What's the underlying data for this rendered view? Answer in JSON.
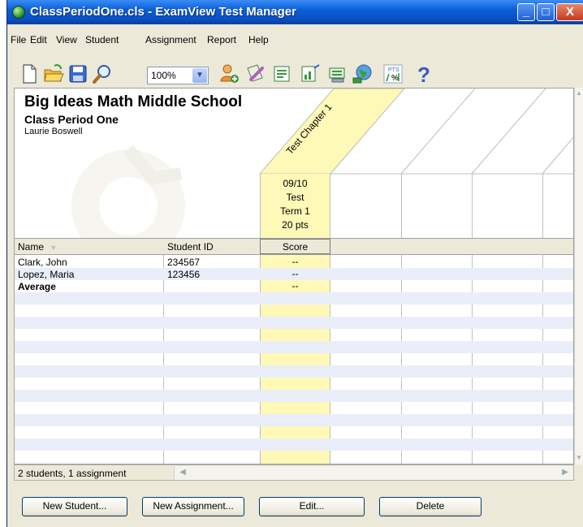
{
  "window": {
    "title": "ClassPeriodOne.cls - ExamView Test Manager",
    "controls": [
      "_",
      "□",
      "X"
    ]
  },
  "menu": [
    "File",
    "Edit",
    "View",
    "Student",
    "Assignment",
    "Report",
    "Help"
  ],
  "toolbar": {
    "icons": [
      "new-file-icon",
      "open-folder-icon",
      "save-icon",
      "search-icon",
      "add-student-icon",
      "edit-assignment-icon",
      "report-icon",
      "chart-icon",
      "import-icon",
      "online-icon",
      "points-percent-icon",
      "help-icon"
    ],
    "zoom": "100%",
    "pts_label": "PTS",
    "pct_label": "%"
  },
  "school": {
    "name": "Big Ideas Math Middle School",
    "class_name": "Class Period One",
    "teacher": "Laurie Boswell"
  },
  "assignment": {
    "title": "Test Chapter 1",
    "date": "09/10",
    "type": "Test",
    "term": "Term 1",
    "points": "20 pts"
  },
  "columns": {
    "name": "Name",
    "sort_icon": "▼",
    "student_id": "Student ID",
    "score": "Score"
  },
  "rows": [
    {
      "name": "Clark, John",
      "id": "234567",
      "score": "--"
    },
    {
      "name": "Lopez, Maria",
      "id": "123456",
      "score": "--"
    },
    {
      "name": "Average",
      "id": "",
      "score": "--"
    }
  ],
  "status": "2 students, 1 assignment",
  "buttons": {
    "new_student": "New Student...",
    "new_assignment": "New Assignment...",
    "edit": "Edit...",
    "delete": "Delete"
  }
}
